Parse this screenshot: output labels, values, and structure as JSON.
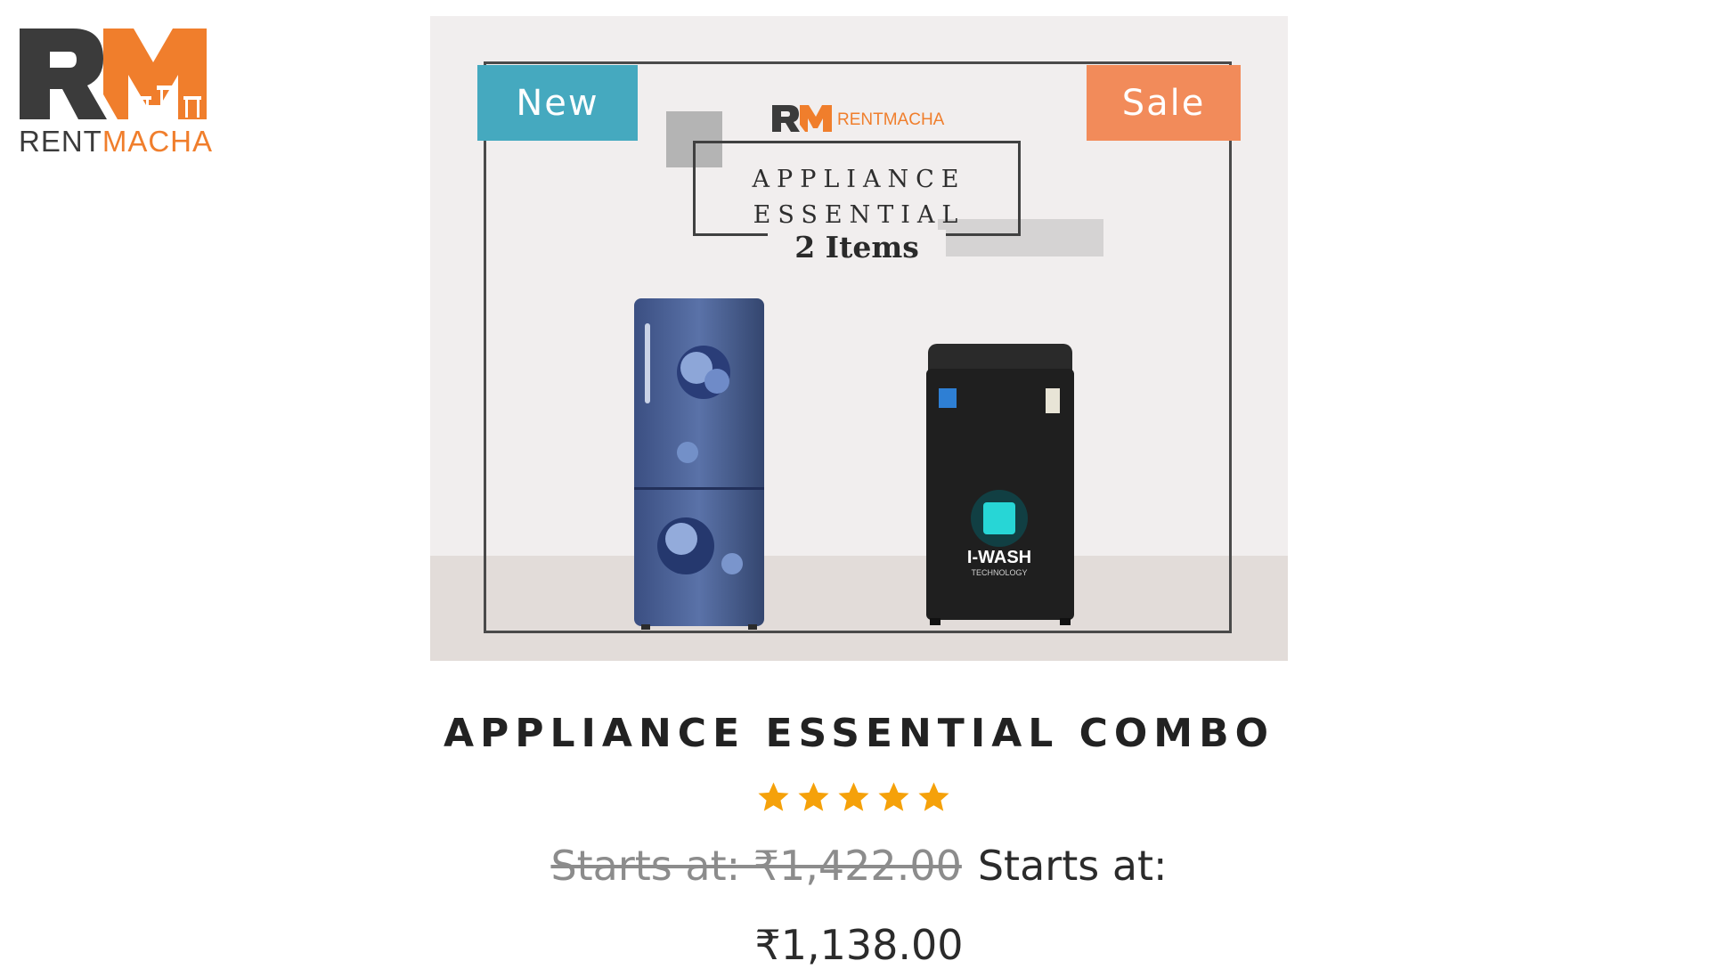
{
  "brand": {
    "logo_letters": "RM",
    "name_part1": "RENT",
    "name_part2": "MACHA",
    "dark_color": "#3b3b3b",
    "accent_color": "#f07e2c"
  },
  "product_image": {
    "badge_new": "New",
    "badge_sale": "Sale",
    "inner_brand": "RENTMACHA",
    "banner_line1": "APPLIANCE",
    "banner_line2": "ESSENTIAL",
    "banner_count": "2 Items",
    "washer_label": "I-WASH",
    "washer_sublabel": "TECHNOLOGY",
    "badge_new_color": "#45a9bf",
    "badge_sale_color": "#f28b5a"
  },
  "product": {
    "title": "APPLIANCE ESSENTIAL COMBO",
    "rating": 5,
    "rating_max": 5,
    "star_color": "#f5a10a",
    "price_old": "Starts at: ₹1,422.00",
    "price_label": "Starts at:",
    "price_new": "₹1,138.00"
  }
}
